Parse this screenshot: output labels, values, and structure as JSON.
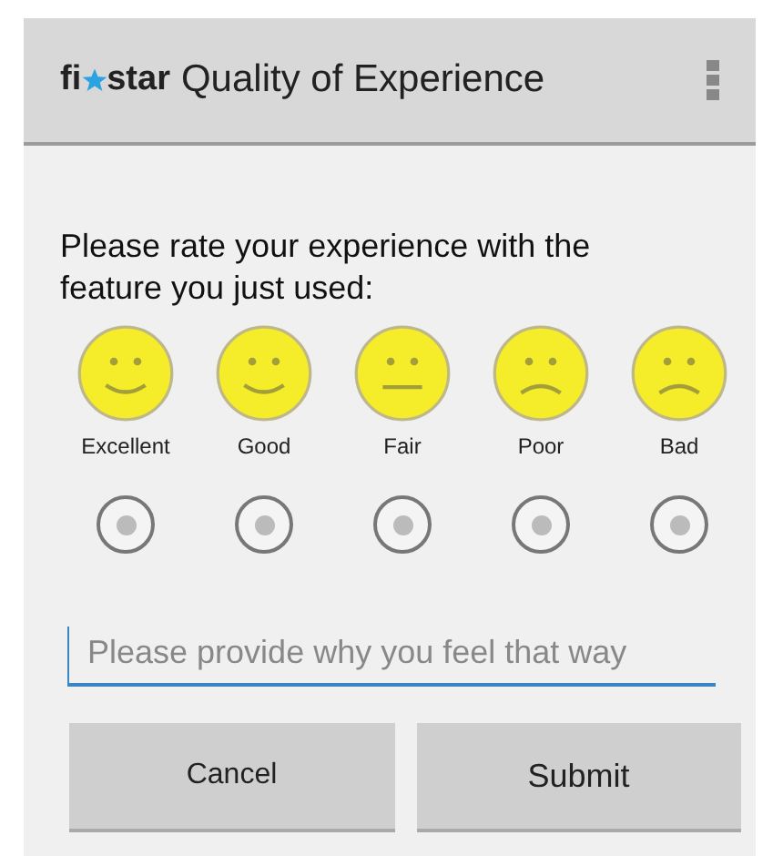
{
  "app_bar": {
    "logo": {
      "prefix": "fi",
      "suffix": "star"
    },
    "title": "Quality of Experience"
  },
  "prompt": "Please rate your experience with the feature you just used:",
  "ratings": [
    {
      "label": "Excellent",
      "kind": "smile",
      "selected": false
    },
    {
      "label": "Good",
      "kind": "smile",
      "selected": false
    },
    {
      "label": "Fair",
      "kind": "flat",
      "selected": false
    },
    {
      "label": "Poor",
      "kind": "frown",
      "selected": false
    },
    {
      "label": "Bad",
      "kind": "frown",
      "selected": false
    }
  ],
  "comment": {
    "placeholder": "Please provide why you feel that way"
  },
  "buttons": [
    {
      "label": "Cancel"
    },
    {
      "label": "Submit"
    }
  ]
}
